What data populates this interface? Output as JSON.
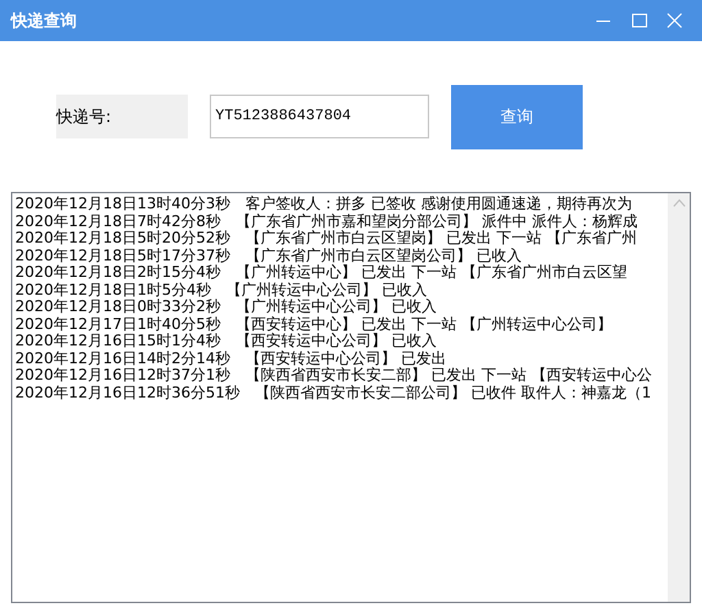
{
  "window": {
    "title": "快递查询"
  },
  "form": {
    "label": "快递号:",
    "tracking_number": "YT5123886437804",
    "button": "查询"
  },
  "log": {
    "lines": [
      "2020年12月18日13时40分3秒　客户签收人：拼多 已签收 感谢使用圆通速递，期待再次为",
      "2020年12月18日7时42分8秒　【广东省广州市嘉和望岗分部公司】 派件中 派件人：杨辉成",
      "2020年12月18日5时20分52秒　【广东省广州市白云区望岗】 已发出 下一站 【广东省广州",
      "2020年12月18日5时17分37秒　【广东省广州市白云区望岗公司】 已收入",
      "2020年12月18日2时15分4秒　【广州转运中心】 已发出 下一站 【广东省广州市白云区望",
      "2020年12月18日1时5分4秒　【广州转运中心公司】 已收入",
      "2020年12月18日0时33分2秒　【广州转运中心公司】 已收入",
      "2020年12月17日1时40分5秒　【西安转运中心】 已发出 下一站 【广州转运中心公司】",
      "2020年12月16日15时1分4秒　【西安转运中心公司】 已收入",
      "2020年12月16日14时2分14秒　【西安转运中心公司】 已发出",
      "2020年12月16日12时37分1秒　【陕西省西安市长安二部】 已发出 下一站 【西安转运中心公",
      "2020年12月16日12时36分51秒　【陕西省西安市长安二部公司】 已收件 取件人：神嘉龙（1"
    ]
  }
}
